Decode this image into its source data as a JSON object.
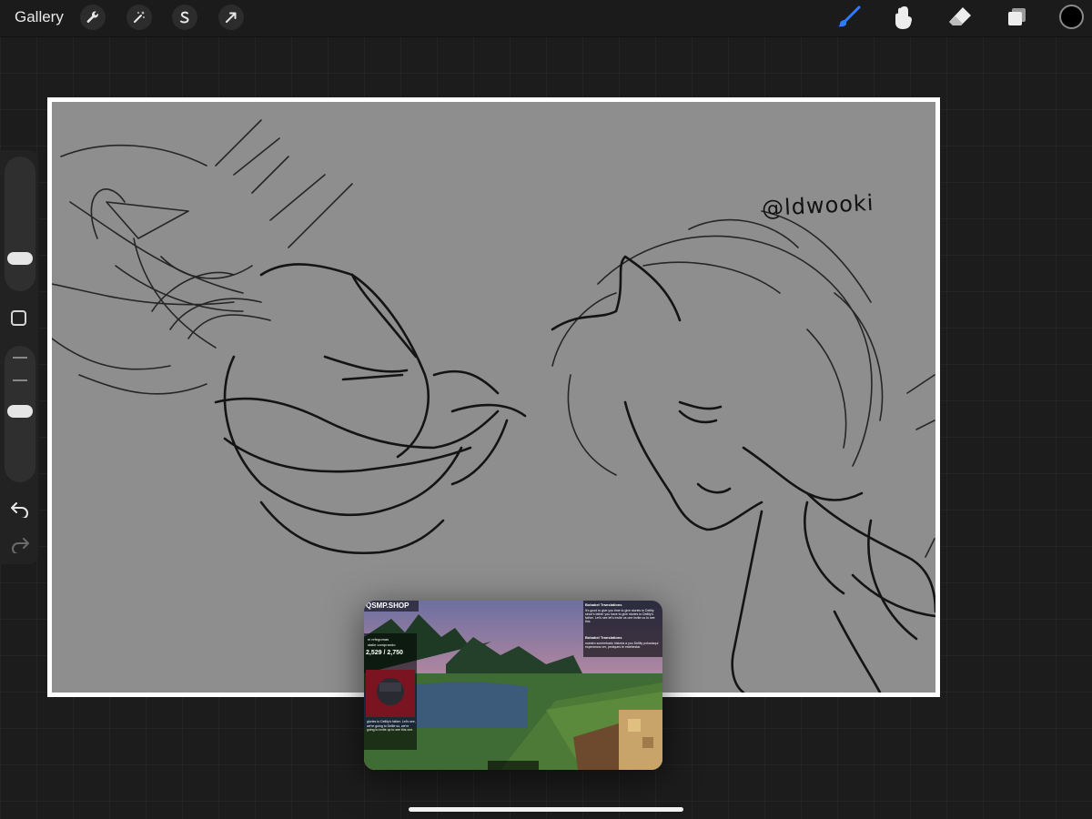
{
  "topbar": {
    "gallery_label": "Gallery",
    "left_tools": [
      "wrench-icon",
      "magic-wand-icon",
      "selection-icon",
      "transform-arrow-icon"
    ],
    "right_tools": [
      "brush-icon",
      "smudge-icon",
      "eraser-icon",
      "layers-icon"
    ],
    "active_tool": "brush",
    "accent_color": "#2f7bff",
    "current_color": "#000000"
  },
  "sidebar": {
    "brush_size_level": 0.2,
    "opacity_level": 0.55,
    "controls": [
      "modify-square-icon",
      "undo-icon",
      "redo-icon"
    ]
  },
  "canvas": {
    "background_color": "#8d8e8d",
    "signature": "@ldwooki"
  },
  "pip_video": {
    "channel": "QSMP.SHOP",
    "sub_goal_label": "ni refegomas",
    "sub_goal_sub": "stalle comprando",
    "sub_count": "2,529 / 2,750",
    "chat_header_1": "Bobabel Translations",
    "chat_msg_1": "It's good to give you time to give stories to Dellity since's father you have to give stories to Dellity's father. Let's see let's invite us one invite us to see this",
    "chat_header_2": "Bobabel Translations",
    "chat_msg_2": "nuestro sonrimbado historia a you Dellity pokadaqui esperamos ver, pediques te estebestar.",
    "subtitle": "glories to Dellity's father. Let's see, we're going to Dellie so, we're going to invite up to see this one."
  }
}
